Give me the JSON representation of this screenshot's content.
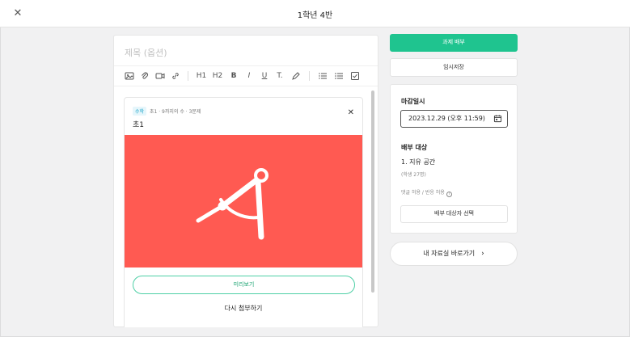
{
  "header": {
    "title": "1학년 4반",
    "close_icon": "close-icon"
  },
  "editor": {
    "title_placeholder": "제목 (옵션)",
    "toolbar": [
      {
        "name": "image-icon",
        "label": ""
      },
      {
        "name": "attach-icon",
        "label": ""
      },
      {
        "name": "video-icon",
        "label": ""
      },
      {
        "name": "link-icon",
        "label": ""
      },
      {
        "name": "heading1-button",
        "label": "H1"
      },
      {
        "name": "heading2-button",
        "label": "H2"
      },
      {
        "name": "bold-button",
        "label": "B"
      },
      {
        "name": "italic-button",
        "label": "I"
      },
      {
        "name": "underline-button",
        "label": "U"
      },
      {
        "name": "text-style-button",
        "label": "T."
      },
      {
        "name": "highlight-icon",
        "label": ""
      },
      {
        "name": "ordered-list-icon",
        "label": ""
      },
      {
        "name": "bullet-list-icon",
        "label": ""
      },
      {
        "name": "checklist-icon",
        "label": ""
      }
    ]
  },
  "attachment": {
    "tag": "수학",
    "meta": "초1 · 9까지의 수 · 3문제",
    "title": "초1",
    "thumb_color": "#ff5a52",
    "thumb_icon": "compass-icon",
    "preview_label": "미리보기",
    "reattach_label": "다시 첨부하기"
  },
  "actions": {
    "submit_label": "과제 배부",
    "save_label": "임시저장",
    "accent_color": "#1fc48f"
  },
  "settings": {
    "deadline_label": "마감일시",
    "deadline_value": "2023.12.29 (오후 11:59)",
    "target_label": "배부 대상",
    "target_name": "1. 지유 공간",
    "target_count": "(학생 27명)",
    "permission_text": "댓글 허용 / 반응 허용",
    "select_target_label": "배부 대상자 선택"
  },
  "shortcut": {
    "label": "내 자료실 바로가기"
  }
}
